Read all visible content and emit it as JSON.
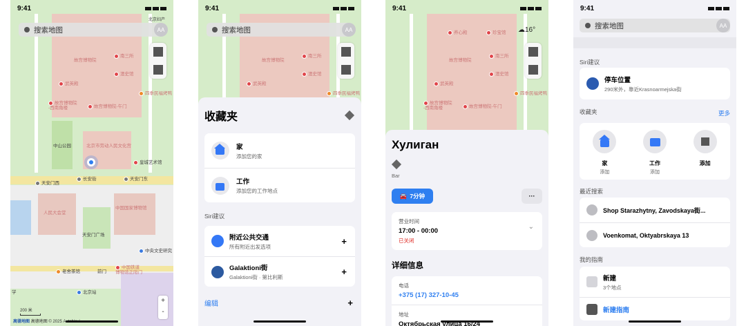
{
  "status": {
    "time": "9:41"
  },
  "search": {
    "placeholder": "搜索地图",
    "avatar": "AA"
  },
  "map_labels": {
    "palace": "故宫博物院",
    "nansansuo": "南三所",
    "wuyingdian": "武英殿",
    "xiantang": "澳史馆",
    "siji": "四季民福烤鸭",
    "palace_sw": "故宫博物院\n-西南角楼",
    "palace_wumen": "故宫博物院-午门",
    "zhongshan": "中山公园",
    "laodong": "北京市劳动人民文化宫",
    "huangcheng": "皇城艺术馆",
    "changan": "长安街",
    "tiananmen_w": "天安门西",
    "tiananmen_e": "天安门东",
    "museum": "中国国家博物馆",
    "dahuitang": "人民大会堂",
    "square": "天安门广场",
    "zhongyang": "中央文史研究",
    "qianmen": "前门",
    "laoshe": "老舍茶馆",
    "railway": "中国铁道\n博物馆正阳门",
    "beijingzhan": "北京站",
    "yangxin": "养心殿",
    "zhenbao": "珍宝馆",
    "beijing_top": "北京妇产",
    "daxue": "学"
  },
  "map_extra": {
    "scale": "200 米",
    "attribution": "高德地图 © 2025 AutoNavi",
    "attribution_brand": "高德地图",
    "weather": "16°",
    "zoom_in": "+",
    "zoom_out": "-"
  },
  "favorites_sheet": {
    "title": "收藏夹",
    "items": [
      {
        "title": "家",
        "subtitle": "添加您的家"
      },
      {
        "title": "工作",
        "subtitle": "添加您的工作地点"
      }
    ],
    "siri_header": "Siri建议",
    "siri_items": [
      {
        "title": "附近公共交通",
        "subtitle": "所有附近出发选项",
        "action": "+"
      },
      {
        "title": "Galaktioni街",
        "subtitle": "Galaktioni街 · 第比利斯",
        "action": "+"
      }
    ],
    "edit": "编辑",
    "edit_plus": "+"
  },
  "place_sheet": {
    "name": "Хулиган",
    "category": "Bar",
    "route_button": "7分钟",
    "more": "···",
    "hours_label": "营业时间",
    "hours": "17:00 - 00:00",
    "closed": "已关闭",
    "details_header": "详细信息",
    "phone_label": "电话",
    "phone": "+375 (17) 327-10-45",
    "address_label": "地址",
    "address": "Октябрьская улица 16/24"
  },
  "home_panel": {
    "siri_header": "Siri建议",
    "parking": {
      "title": "停车位置",
      "subtitle": "290米外，靠近Krasnoarmejska街"
    },
    "favorites_header": "收藏夹",
    "more": "更多",
    "favorites": [
      {
        "title": "家",
        "subtitle": "添加"
      },
      {
        "title": "工作",
        "subtitle": "添加"
      },
      {
        "title": "添加",
        "subtitle": ""
      }
    ],
    "recent_header": "最近搜索",
    "recents": [
      "Shop Starazhytny, Zavodskaya街...",
      "Voenkomat, Oktyabrskaya 13"
    ],
    "guides_header": "我的指南",
    "guide": {
      "title": "新建",
      "subtitle": "3个地点"
    },
    "new_guide": "新建指南"
  },
  "colors": {
    "accent": "#2f7ff0",
    "closed": "#e0302a",
    "park": "#cfe8c4",
    "palace": "#ecc9c0"
  }
}
